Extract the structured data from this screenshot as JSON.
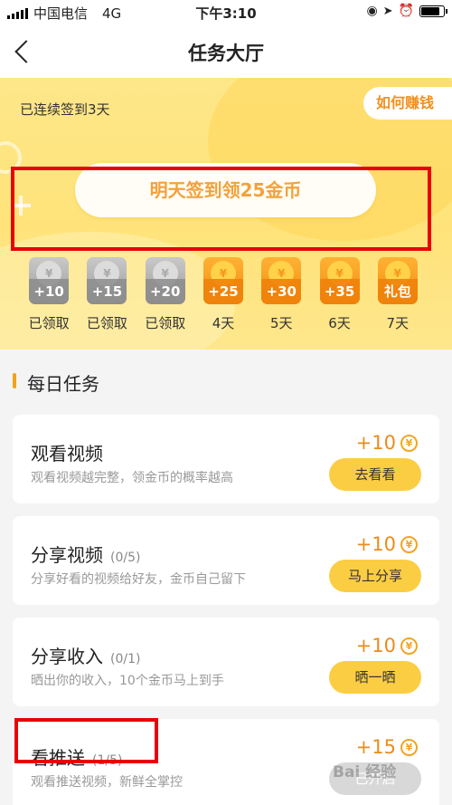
{
  "status_bar": {
    "carrier": "中国电信",
    "network": "4G",
    "time": "下午3:10"
  },
  "nav": {
    "title": "任务大厅"
  },
  "banner": {
    "streak_text": "已连续签到3天",
    "how_to_earn": "如何赚钱",
    "checkin_button": "明天签到领25金币"
  },
  "rewards": [
    {
      "amount": "+10",
      "label": "已领取",
      "state": "claimed"
    },
    {
      "amount": "+15",
      "label": "已领取",
      "state": "claimed"
    },
    {
      "amount": "+20",
      "label": "已领取",
      "state": "claimed"
    },
    {
      "amount": "+25",
      "label": "4天",
      "state": "upcoming"
    },
    {
      "amount": "+30",
      "label": "5天",
      "state": "upcoming"
    },
    {
      "amount": "+35",
      "label": "6天",
      "state": "upcoming"
    },
    {
      "amount": "礼包",
      "label": "7天",
      "state": "upcoming"
    }
  ],
  "coin_symbol": "¥",
  "section": {
    "title": "每日任务"
  },
  "tasks": [
    {
      "title": "观看视频",
      "progress": "",
      "desc": "观看视频越完整，领金币的概率越高",
      "reward": "+10",
      "button": "去看看"
    },
    {
      "title": "分享视频",
      "progress": "(0/5)",
      "desc": "分享好看的视频给好友，金币自己留下",
      "reward": "+10",
      "button": "马上分享"
    },
    {
      "title": "分享收入",
      "progress": "(0/1)",
      "desc": "晒出你的收入，10个金币马上到手",
      "reward": "+10",
      "button": "晒一晒"
    },
    {
      "title": "看推送",
      "progress": "(1/5)",
      "desc": "观看推送视频，新鲜全掌控",
      "reward": "+15",
      "button": "已开启"
    }
  ],
  "watermark": "Bai 经验",
  "colors": {
    "accent_orange": "#f0a318",
    "button_yellow": "#fbcd43",
    "highlight_red": "#e8000b",
    "banner_yellow": "#ffe37a"
  },
  "battery_level": 0.85
}
